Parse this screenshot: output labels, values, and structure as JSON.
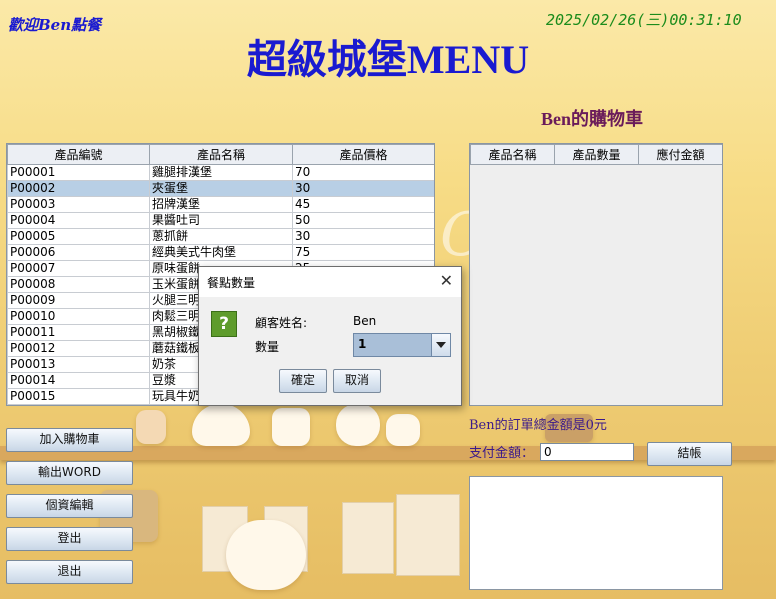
{
  "header": {
    "welcome": "歡迎Ben點餐",
    "datetime": "2025/02/26(三)00:31:10",
    "title": "超級城堡MENU",
    "cart_title": "Ben的購物車"
  },
  "product_table": {
    "columns": [
      "產品編號",
      "產品名稱",
      "產品價格"
    ],
    "rows": [
      [
        "P00001",
        "雞腿排漢堡",
        "70"
      ],
      [
        "P00002",
        "夾蛋堡",
        "30"
      ],
      [
        "P00003",
        "招牌漢堡",
        "45"
      ],
      [
        "P00004",
        "果醬吐司",
        "50"
      ],
      [
        "P00005",
        "蔥抓餅",
        "30"
      ],
      [
        "P00006",
        "經典美式牛肉堡",
        "75"
      ],
      [
        "P00007",
        "原味蛋餅",
        "25"
      ],
      [
        "P00008",
        "玉米蛋餅",
        ""
      ],
      [
        "P00009",
        "火腿三明",
        ""
      ],
      [
        "P00010",
        "肉鬆三明",
        ""
      ],
      [
        "P00011",
        "黑胡椒鐵",
        ""
      ],
      [
        "P00012",
        "蘑菇鐵板",
        ""
      ],
      [
        "P00013",
        "奶茶",
        ""
      ],
      [
        "P00014",
        "豆漿",
        ""
      ],
      [
        "P00015",
        "玩具牛奶",
        ""
      ]
    ],
    "selected_index": 1
  },
  "cart_table": {
    "columns": [
      "產品名稱",
      "產品數量",
      "應付金額"
    ]
  },
  "buttons": {
    "add_to_cart": "加入購物車",
    "export_word": "輸出WORD",
    "edit_profile": "個資編輯",
    "logout": "登出",
    "exit": "退出",
    "checkout": "結帳"
  },
  "summary": {
    "total_text": "Ben的訂單總金額是0元",
    "pay_label": "支付金額：",
    "pay_value": "0"
  },
  "dialog": {
    "title": "餐點數量",
    "customer_label": "顧客姓名:",
    "customer_name": "Ben",
    "quantity_label": "數量",
    "quantity_value": "1",
    "ok": "確定",
    "cancel": "取消",
    "icon": "question-icon"
  }
}
